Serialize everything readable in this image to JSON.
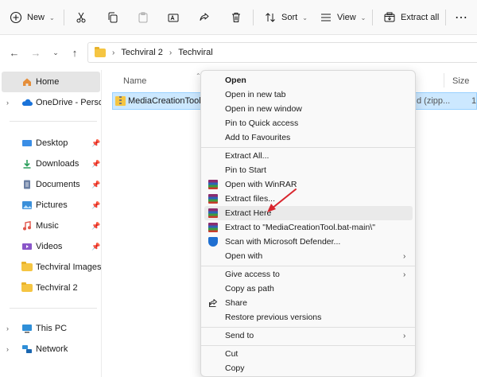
{
  "toolbar": {
    "new_label": "New",
    "sort_label": "Sort",
    "view_label": "View",
    "extract_all_label": "Extract all"
  },
  "breadcrumb": [
    "Techviral 2",
    "Techviral"
  ],
  "sidebar": {
    "items": [
      {
        "label": "Home",
        "icon": "home-icon"
      },
      {
        "label": "OneDrive - Persona",
        "icon": "cloud-icon"
      },
      {
        "label": "Desktop",
        "icon": "desktop-icon"
      },
      {
        "label": "Downloads",
        "icon": "download-icon"
      },
      {
        "label": "Documents",
        "icon": "documents-icon"
      },
      {
        "label": "Pictures",
        "icon": "pictures-icon"
      },
      {
        "label": "Music",
        "icon": "music-icon"
      },
      {
        "label": "Videos",
        "icon": "videos-icon"
      },
      {
        "label": "Techviral Images",
        "icon": "folder-icon"
      },
      {
        "label": "Techviral 2",
        "icon": "folder-icon"
      },
      {
        "label": "This PC",
        "icon": "pc-icon"
      },
      {
        "label": "Network",
        "icon": "network-icon"
      }
    ]
  },
  "columns": {
    "name": "Name",
    "size": "Size"
  },
  "file": {
    "name": "MediaCreationTool.ba",
    "type": "d (zipp...",
    "size": "1"
  },
  "context_menu": {
    "items": [
      {
        "label": "Open"
      },
      {
        "label": "Open in new tab"
      },
      {
        "label": "Open in new window"
      },
      {
        "label": "Pin to Quick access"
      },
      {
        "label": "Add to Favourites"
      },
      {
        "label": "Extract All..."
      },
      {
        "label": "Pin to Start"
      },
      {
        "label": "Open with WinRAR"
      },
      {
        "label": "Extract files..."
      },
      {
        "label": "Extract Here"
      },
      {
        "label": "Extract to \"MediaCreationTool.bat-main\\\""
      },
      {
        "label": "Scan with Microsoft Defender..."
      },
      {
        "label": "Open with"
      },
      {
        "label": "Give access to"
      },
      {
        "label": "Copy as path"
      },
      {
        "label": "Share"
      },
      {
        "label": "Restore previous versions"
      },
      {
        "label": "Send to"
      },
      {
        "label": "Cut"
      },
      {
        "label": "Copy"
      }
    ]
  },
  "colors": {
    "accent": "#0067c0",
    "selection": "#cce8ff",
    "annotation_arrow": "#d9262e"
  }
}
